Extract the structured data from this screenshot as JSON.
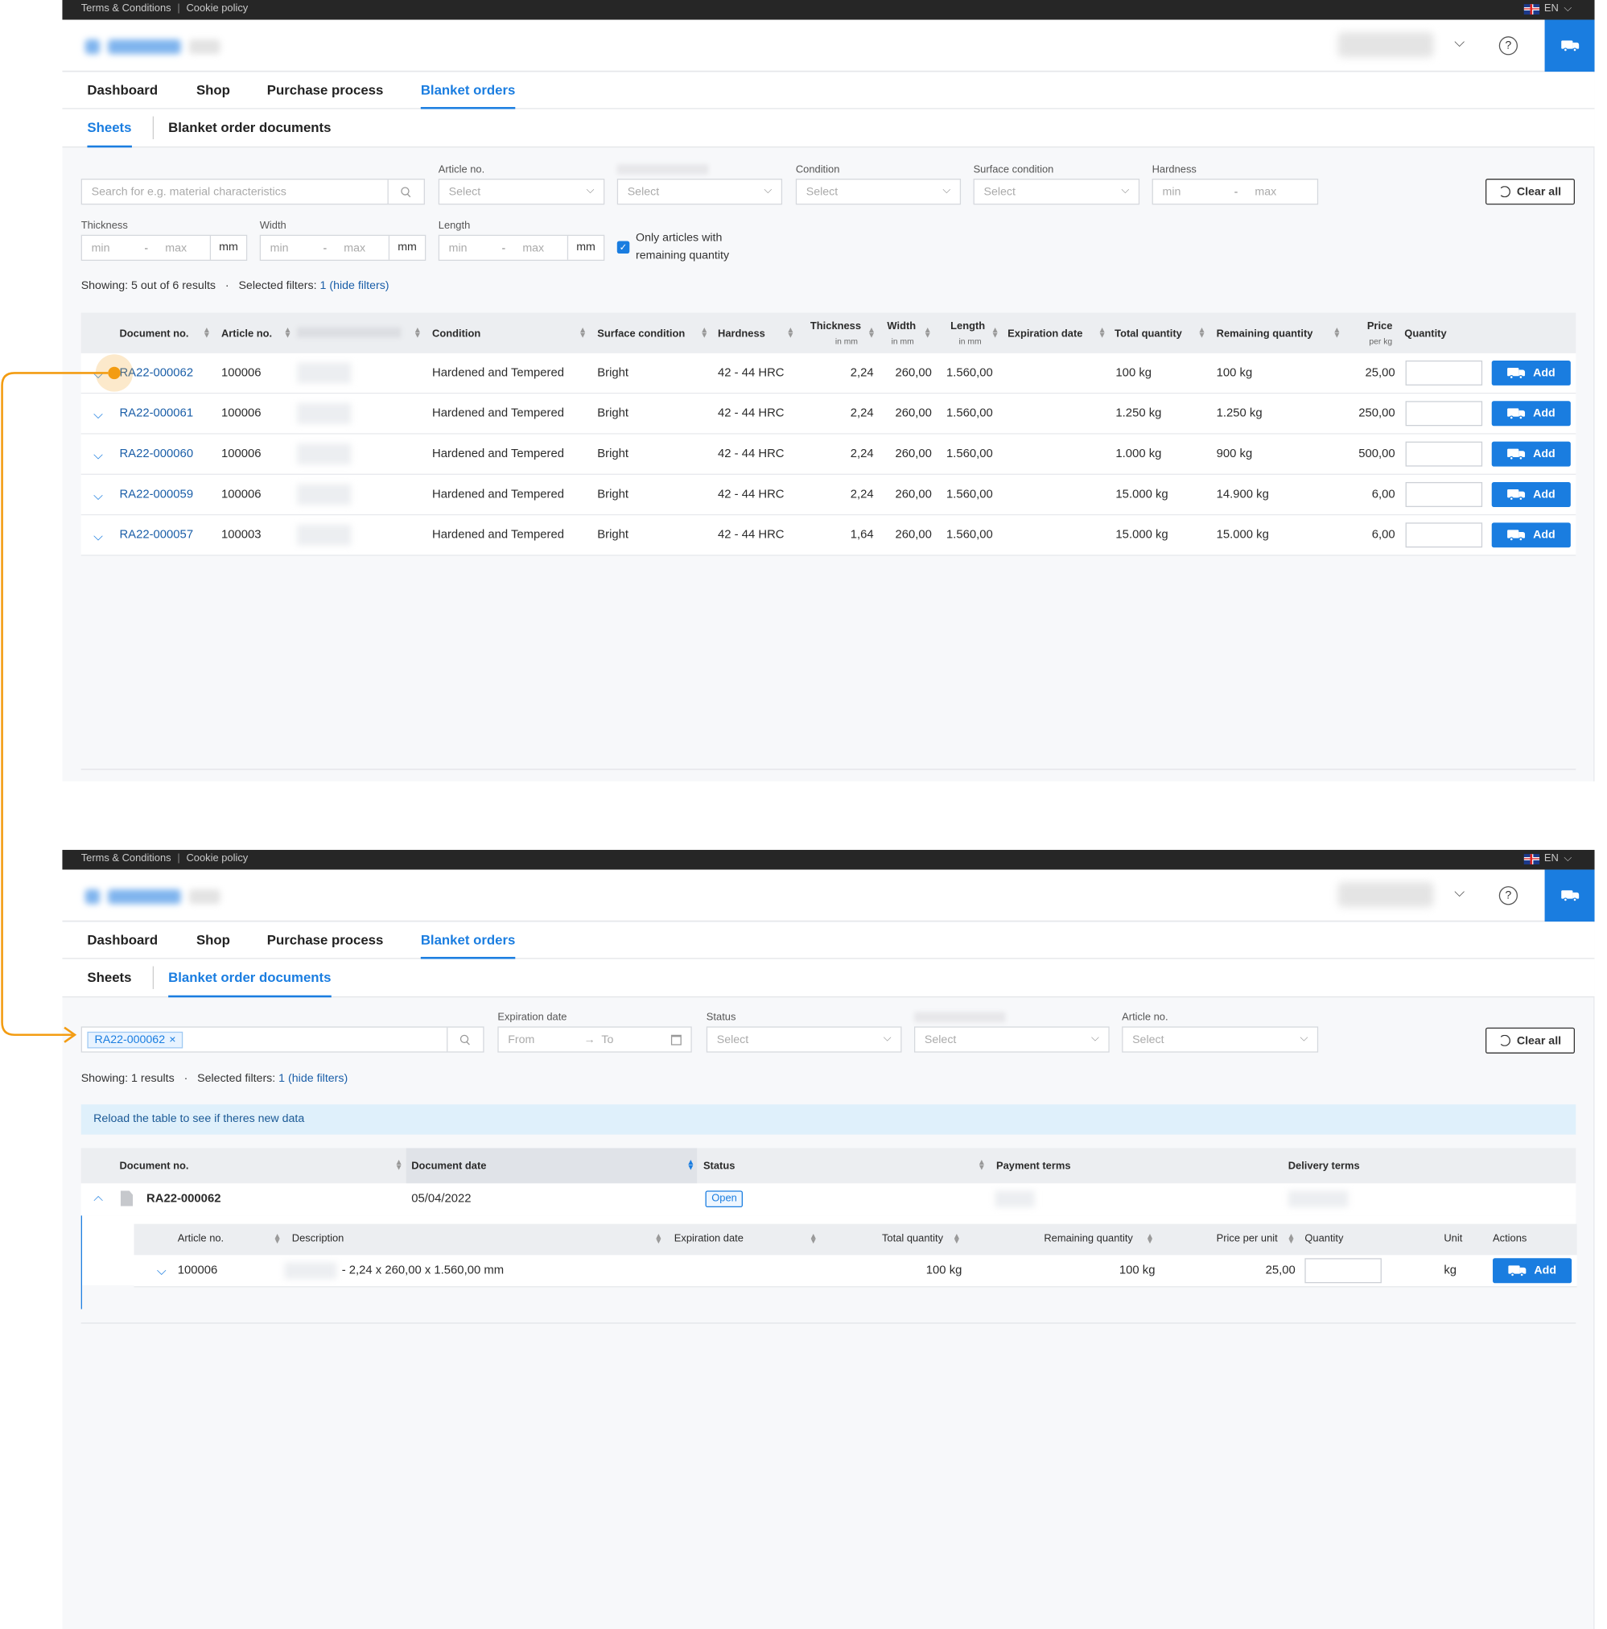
{
  "topbar": {
    "terms": "Terms & Conditions",
    "separator": "|",
    "cookie": "Cookie policy",
    "lang": "EN"
  },
  "help_label": "?",
  "nav": {
    "dashboard": "Dashboard",
    "shop": "Shop",
    "purchase": "Purchase process",
    "blanket": "Blanket orders"
  },
  "subnav": {
    "sheets": "Sheets",
    "documents": "Blanket order documents"
  },
  "sheets_screen": {
    "search_placeholder": "Search for e.g. material characteristics",
    "article_label": "Article no.",
    "condition_label": "Condition",
    "surface_label": "Surface condition",
    "hardness_label": "Hardness",
    "thickness_label": "Thickness",
    "width_label": "Width",
    "length_label": "Length",
    "select": "Select",
    "min": "min",
    "max": "max",
    "dash": "-",
    "unit": "mm",
    "only_remaining": "Only articles with remaining quantity",
    "only_remaining_checked": true,
    "clear_all": "Clear all",
    "showing": "Showing: 5 out of 6 results",
    "dot": "·",
    "selected_filters": "Selected filters:",
    "selected_count": "1",
    "hide_filters": "(hide filters)",
    "columns": {
      "doc": "Document no.",
      "article": "Article no.",
      "condition": "Condition",
      "surface": "Surface condition",
      "hardness": "Hardness",
      "thickness": "Thickness",
      "width": "Width",
      "length": "Length",
      "in_mm": "in mm",
      "expiration": "Expiration date",
      "total": "Total quantity",
      "remaining": "Remaining quantity",
      "price": "Price",
      "per_kg": "per kg",
      "quantity": "Quantity"
    },
    "add": "Add",
    "rows": [
      {
        "doc": "RA22-000062",
        "article": "100006",
        "condition": "Hardened and Tempered",
        "surface": "Bright",
        "hardness": "42 - 44 HRC",
        "thickness": "2,24",
        "width": "260,00",
        "length": "1.560,00",
        "total": "100 kg",
        "remaining": "100 kg",
        "price": "25,00"
      },
      {
        "doc": "RA22-000061",
        "article": "100006",
        "condition": "Hardened and Tempered",
        "surface": "Bright",
        "hardness": "42 - 44 HRC",
        "thickness": "2,24",
        "width": "260,00",
        "length": "1.560,00",
        "total": "1.250 kg",
        "remaining": "1.250 kg",
        "price": "250,00"
      },
      {
        "doc": "RA22-000060",
        "article": "100006",
        "condition": "Hardened and Tempered",
        "surface": "Bright",
        "hardness": "42 - 44 HRC",
        "thickness": "2,24",
        "width": "260,00",
        "length": "1.560,00",
        "total": "1.000 kg",
        "remaining": "900 kg",
        "price": "500,00"
      },
      {
        "doc": "RA22-000059",
        "article": "100006",
        "condition": "Hardened and Tempered",
        "surface": "Bright",
        "hardness": "42 - 44 HRC",
        "thickness": "2,24",
        "width": "260,00",
        "length": "1.560,00",
        "total": "15.000 kg",
        "remaining": "14.900 kg",
        "price": "6,00"
      },
      {
        "doc": "RA22-000057",
        "article": "100003",
        "condition": "Hardened and Tempered",
        "surface": "Bright",
        "hardness": "42 - 44 HRC",
        "thickness": "1,64",
        "width": "260,00",
        "length": "1.560,00",
        "total": "15.000 kg",
        "remaining": "15.000 kg",
        "price": "6,00"
      }
    ]
  },
  "documents_screen": {
    "search_tag": "RA22-000062",
    "tag_close": "×",
    "expiration_label": "Expiration date",
    "from": "From",
    "arrow": "→",
    "to": "To",
    "status_label": "Status",
    "article_label": "Article no.",
    "select": "Select",
    "clear_all": "Clear all",
    "showing": "Showing: 1 results",
    "dot": "·",
    "selected_filters": "Selected filters:",
    "selected_count": "1",
    "hide_filters": "(hide filters)",
    "reload_notice": "Reload the table to see if theres new data",
    "columns": {
      "doc": "Document no.",
      "date": "Document date",
      "status": "Status",
      "payment": "Payment terms",
      "delivery": "Delivery terms"
    },
    "document": {
      "number": "RA22-000062",
      "date": "05/04/2022",
      "status": "Open"
    },
    "sub_columns": {
      "article": "Article no.",
      "description": "Description",
      "expiration": "Expiration date",
      "total": "Total quantity",
      "remaining": "Remaining quantity",
      "price": "Price per unit",
      "quantity": "Quantity",
      "unit": "Unit",
      "actions": "Actions"
    },
    "sub_row": {
      "article": "100006",
      "description": "- 2,24 x 260,00 x 1.560,00 mm",
      "total": "100 kg",
      "remaining": "100 kg",
      "price": "25,00",
      "unit": "kg",
      "add": "Add"
    }
  },
  "colors": {
    "accent": "#1a7de0",
    "link": "#1a5ea8",
    "annotation": "#f39c12",
    "topbar": "#262626"
  }
}
